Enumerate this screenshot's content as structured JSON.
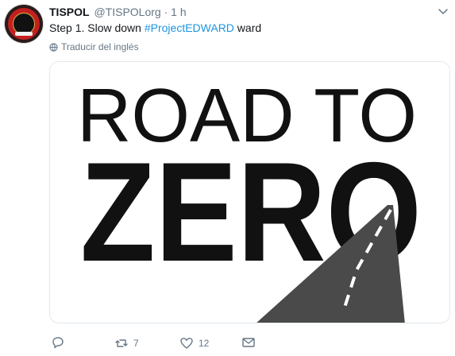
{
  "tweet": {
    "author_name": "TISPOL",
    "handle": "@TISPOLorg",
    "separator": "·",
    "time": "1 h",
    "text_prefix": "Step 1. Slow down ",
    "hashtag": "#ProjectEDWARD",
    "text_suffix": " ward",
    "translate_label": "Traducir del inglés",
    "image_line1": "ROAD TO",
    "image_line2": "ZERO"
  },
  "actions": {
    "reply_count": "",
    "retweet_count": "7",
    "like_count": "12"
  },
  "colors": {
    "hashtag": "#1b95e0",
    "muted": "#657786",
    "road": "#4a4a4a",
    "lettering": "#111111"
  }
}
